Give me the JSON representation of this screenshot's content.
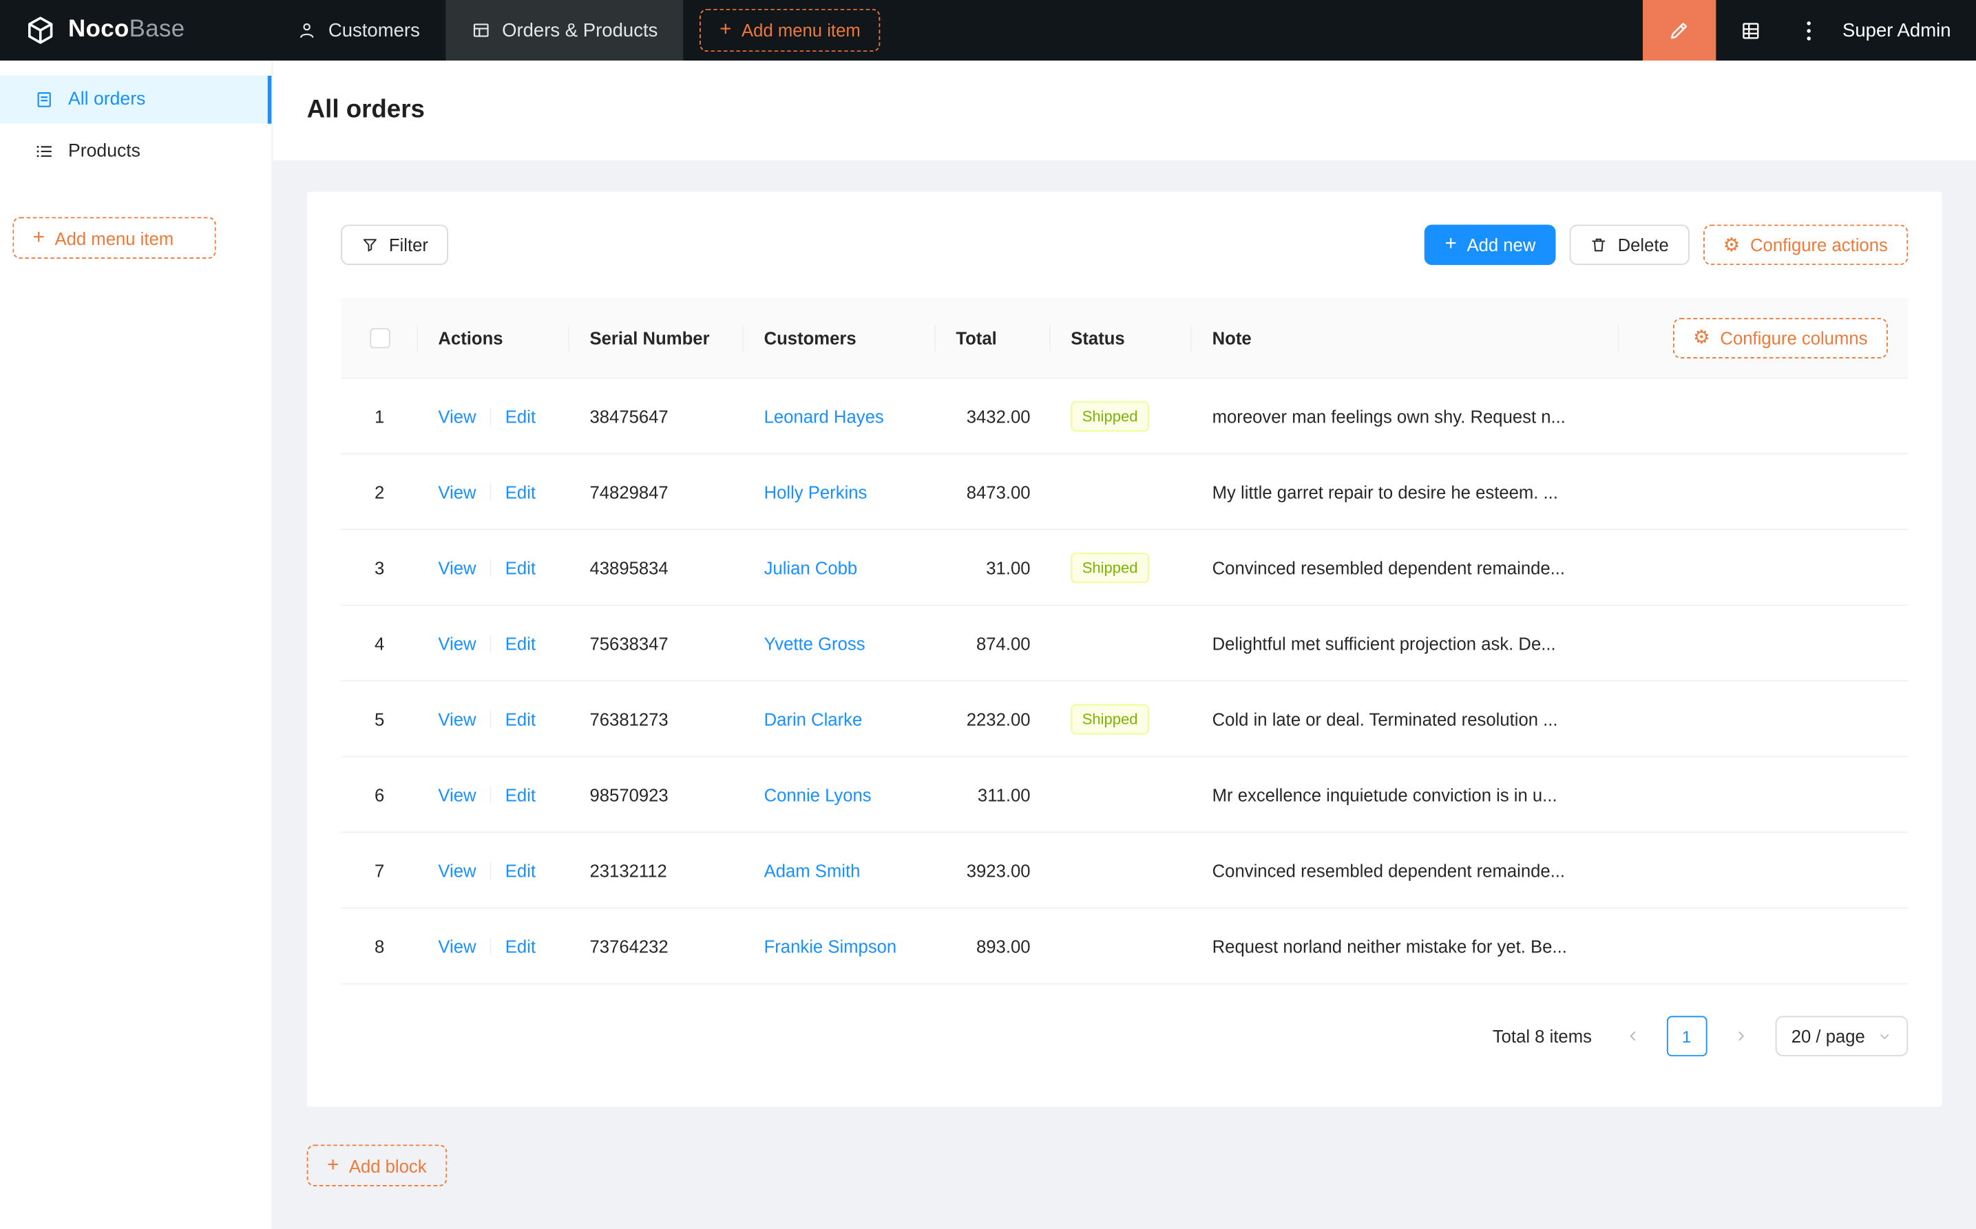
{
  "header": {
    "brand_bold": "Noco",
    "brand_light": "Base",
    "nav": [
      {
        "label": "Customers"
      },
      {
        "label": "Orders & Products"
      }
    ],
    "add_menu_item_label": "Add menu item",
    "user": "Super Admin"
  },
  "sidebar": {
    "items": [
      {
        "label": "All orders",
        "active": true
      },
      {
        "label": "Products",
        "active": false
      }
    ],
    "add_menu_item_label": "Add menu item"
  },
  "page": {
    "title": "All orders"
  },
  "toolbar": {
    "filter_label": "Filter",
    "add_new_label": "Add new",
    "delete_label": "Delete",
    "configure_actions_label": "Configure actions"
  },
  "table": {
    "configure_columns_label": "Configure columns",
    "columns": [
      "Actions",
      "Serial Number",
      "Customers",
      "Total",
      "Status",
      "Note"
    ],
    "action_labels": {
      "view": "View",
      "edit": "Edit"
    },
    "rows": [
      {
        "index": 1,
        "serial": "38475647",
        "customer": "Leonard Hayes",
        "total": "3432.00",
        "status": "Shipped",
        "note": "moreover man feelings own shy. Request n..."
      },
      {
        "index": 2,
        "serial": "74829847",
        "customer": "Holly Perkins",
        "total": "8473.00",
        "status": "",
        "note": "My little garret repair to desire he esteem. ..."
      },
      {
        "index": 3,
        "serial": "43895834",
        "customer": "Julian Cobb",
        "total": "31.00",
        "status": "Shipped",
        "note": "Convinced resembled dependent remainde..."
      },
      {
        "index": 4,
        "serial": "75638347",
        "customer": "Yvette Gross",
        "total": "874.00",
        "status": "",
        "note": "Delightful met sufficient projection ask. De..."
      },
      {
        "index": 5,
        "serial": "76381273",
        "customer": "Darin Clarke",
        "total": "2232.00",
        "status": "Shipped",
        "note": "Cold in late or deal. Terminated resolution ..."
      },
      {
        "index": 6,
        "serial": "98570923",
        "customer": "Connie Lyons",
        "total": "311.00",
        "status": "",
        "note": "Mr excellence inquietude conviction is in u..."
      },
      {
        "index": 7,
        "serial": "23132112",
        "customer": "Adam Smith",
        "total": "3923.00",
        "status": "",
        "note": "Convinced resembled dependent remainde..."
      },
      {
        "index": 8,
        "serial": "73764232",
        "customer": "Frankie Simpson",
        "total": "893.00",
        "status": "",
        "note": "Request norland neither mistake for yet. Be..."
      }
    ]
  },
  "pagination": {
    "total_text": "Total 8 items",
    "current_page": "1",
    "page_size": "20 / page"
  },
  "footer": {
    "add_block_label": "Add block"
  },
  "colors": {
    "accent_blue": "#1890ff",
    "accent_orange": "#ee7939",
    "editor_button_bg": "#ee7b55",
    "header_bg": "#10161a",
    "sidebar_active_bg": "#e6f7ff",
    "tag_shipped_bg": "#fcffe6",
    "tag_shipped_border": "#eaff8f",
    "tag_shipped_text": "#7cb305"
  }
}
